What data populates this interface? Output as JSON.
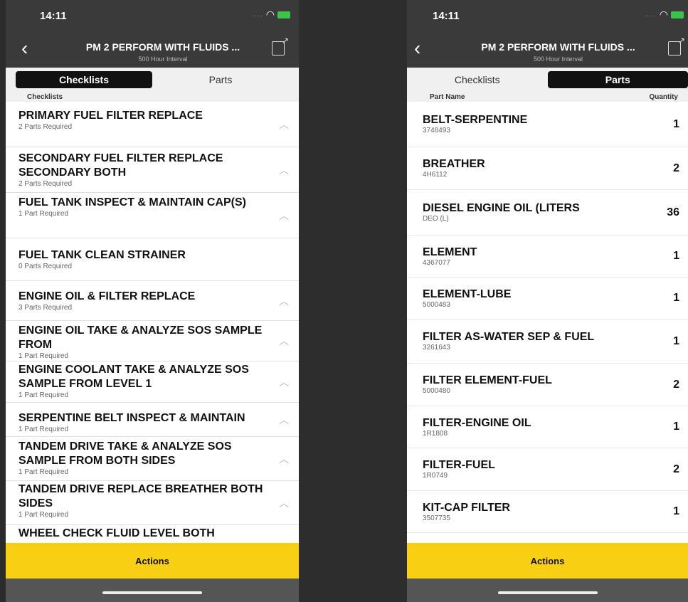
{
  "status": {
    "time": "14:11"
  },
  "header": {
    "title": "PM 2 PERFORM WITH FLUIDS ...",
    "subtitle": "500 Hour Interval"
  },
  "tabs": {
    "checklists": "Checklists",
    "parts": "Parts"
  },
  "left": {
    "section_label": "Checklists",
    "items": [
      {
        "name": "PRIMARY FUEL FILTER REPLACE",
        "sub": "2 Parts Required"
      },
      {
        "name": "SECONDARY FUEL FILTER REPLACE SECONDARY BOTH",
        "sub": "2 Parts Required"
      },
      {
        "name": "FUEL TANK INSPECT & MAINTAIN CAP(S)",
        "sub": "1 Part Required"
      },
      {
        "name": "FUEL TANK CLEAN STRAINER",
        "sub": "0 Parts Required"
      },
      {
        "name": "ENGINE OIL & FILTER REPLACE",
        "sub": "3 Parts Required"
      },
      {
        "name": "ENGINE OIL TAKE & ANALYZE SOS SAMPLE FROM",
        "sub": "1 Part Required"
      },
      {
        "name": "ENGINE COOLANT TAKE & ANALYZE SOS SAMPLE FROM LEVEL 1",
        "sub": "1 Part Required"
      },
      {
        "name": "SERPENTINE BELT INSPECT & MAINTAIN",
        "sub": "1 Part Required"
      },
      {
        "name": "TANDEM DRIVE TAKE & ANALYZE SOS SAMPLE FROM BOTH SIDES",
        "sub": "1 Part Required"
      },
      {
        "name": "TANDEM DRIVE REPLACE BREATHER BOTH SIDES",
        "sub": "1 Part Required"
      },
      {
        "name": "WHEEL CHECK FLUID LEVEL BOTH",
        "sub": ""
      }
    ]
  },
  "right": {
    "col_name": "Part Name",
    "col_qty": "Quantity",
    "parts": [
      {
        "name": "BELT-SERPENTINE",
        "code": "3748493",
        "qty": "1"
      },
      {
        "name": "BREATHER",
        "code": "4H6112",
        "qty": "2"
      },
      {
        "name": "DIESEL ENGINE OIL (LITERS",
        "code": "DEO (L)",
        "qty": "36"
      },
      {
        "name": "ELEMENT",
        "code": "4367077",
        "qty": "1"
      },
      {
        "name": "ELEMENT-LUBE",
        "code": "5000483",
        "qty": "1"
      },
      {
        "name": "FILTER AS-WATER SEP & FUEL",
        "code": "3261643",
        "qty": "1"
      },
      {
        "name": "FILTER ELEMENT-FUEL",
        "code": "5000480",
        "qty": "2"
      },
      {
        "name": "FILTER-ENGINE OIL",
        "code": "1R1808",
        "qty": "1"
      },
      {
        "name": "FILTER-FUEL",
        "code": "1R0749",
        "qty": "2"
      },
      {
        "name": "KIT-CAP FILTER",
        "code": "3507735",
        "qty": "1"
      }
    ]
  },
  "actions_label": "Actions",
  "colors": {
    "accent": "#f9cf13",
    "header": "#3a3a3a"
  }
}
